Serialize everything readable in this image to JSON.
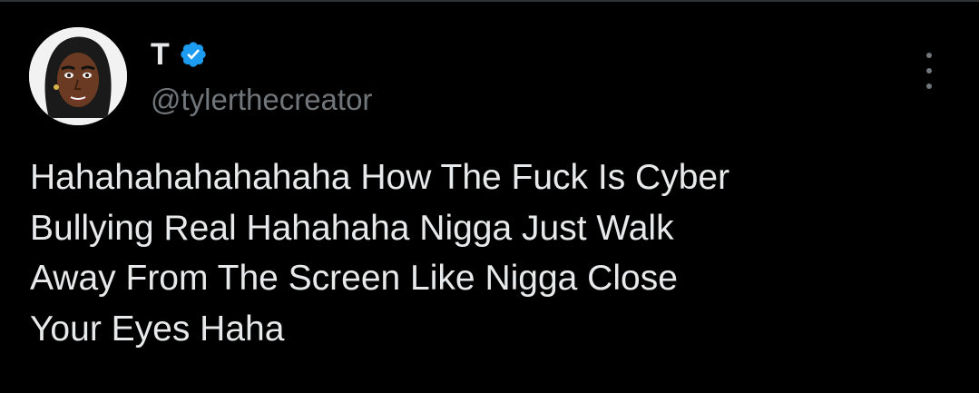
{
  "tweet": {
    "author": {
      "display_name": "T",
      "handle": "@tylerthecreator",
      "verified": true,
      "verified_icon": "verified-badge-icon",
      "avatar_icon": "avatar-cartoon-face"
    },
    "more_icon": "more-vertical-icon",
    "text": "Hahahahahahahaha How The Fuck Is Cyber\nBullying Real Hahahaha Nigga Just Walk\nAway From The Screen Like Nigga Close\nYour Eyes Haha"
  },
  "colors": {
    "background": "#000000",
    "primary_text": "#e7e9ea",
    "secondary_text": "#71767b",
    "verified_blue": "#1d9bf0",
    "divider": "#2f3336"
  }
}
